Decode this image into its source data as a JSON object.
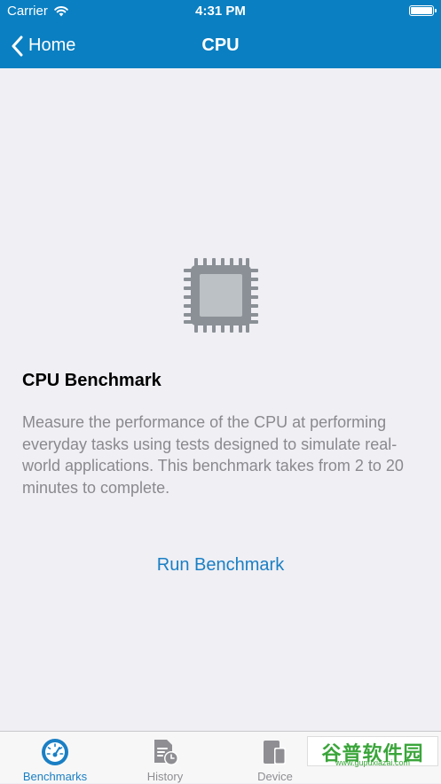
{
  "status_bar": {
    "carrier": "Carrier",
    "time": "4:31 PM"
  },
  "nav": {
    "back_label": "Home",
    "title": "CPU"
  },
  "content": {
    "icon": "cpu-chip-icon",
    "heading": "CPU Benchmark",
    "description": "Measure the performance of the CPU at performing everyday tasks using tests designed to simulate real-world applications. This benchmark takes from 2 to 20 minutes to complete.",
    "action_label": "Run Benchmark"
  },
  "tab_bar": {
    "tabs": [
      {
        "label": "Benchmarks",
        "icon": "speedometer-icon",
        "active": true
      },
      {
        "label": "History",
        "icon": "history-document-icon",
        "active": false
      },
      {
        "label": "Device",
        "icon": "device-icon",
        "active": false
      }
    ]
  },
  "watermark": {
    "title": "谷普软件园",
    "url": "www.gupuxiazai.com"
  },
  "colors": {
    "accent": "#0a7fc1",
    "link": "#1a7fc4",
    "background": "#efeff4",
    "icon_gray": "#8a9096"
  }
}
